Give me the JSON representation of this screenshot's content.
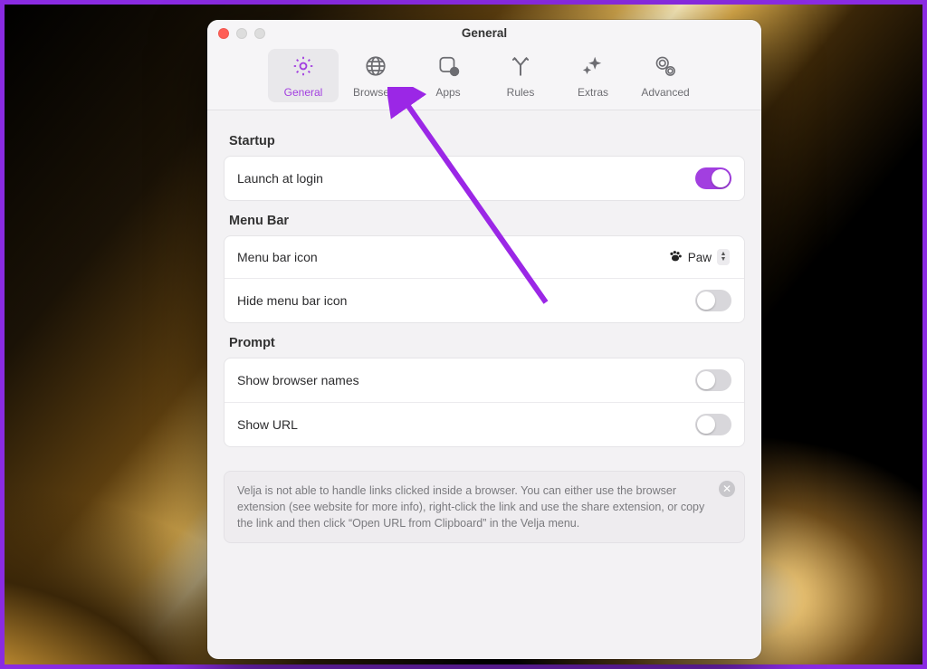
{
  "window": {
    "title": "General"
  },
  "tabs": [
    {
      "label": "General",
      "active": true
    },
    {
      "label": "Browsers",
      "active": false
    },
    {
      "label": "Apps",
      "active": false
    },
    {
      "label": "Rules",
      "active": false
    },
    {
      "label": "Extras",
      "active": false
    },
    {
      "label": "Advanced",
      "active": false
    }
  ],
  "sections": {
    "startup": {
      "title": "Startup",
      "rows": {
        "launch_at_login": {
          "label": "Launch at login",
          "value": true
        }
      }
    },
    "menubar": {
      "title": "Menu Bar",
      "rows": {
        "icon": {
          "label": "Menu bar icon",
          "value": "Paw"
        },
        "hide": {
          "label": "Hide menu bar icon",
          "value": false
        }
      }
    },
    "prompt": {
      "title": "Prompt",
      "rows": {
        "show_names": {
          "label": "Show browser names",
          "value": false
        },
        "show_url": {
          "label": "Show URL",
          "value": false
        }
      }
    }
  },
  "note": {
    "text": "Velja is not able to handle links clicked inside a browser. You can either use the browser extension (see website for more info), right-click the link and use the share extension, or copy the link and then click “Open URL from Clipboard” in the Velja menu."
  },
  "colors": {
    "accent": "#a23fe0"
  },
  "annotation": {
    "target_tab": "Browsers"
  }
}
